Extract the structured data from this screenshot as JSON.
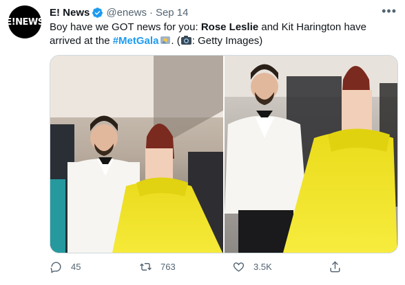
{
  "account": {
    "avatar_text": "E!NEWS",
    "display_name": "E! News",
    "handle": "@enews",
    "separator": "·",
    "date": "Sep 14",
    "verified_icon": "verified-badge-icon"
  },
  "tweet": {
    "text_part1": "Boy have we GOT news for you: ",
    "name1": "Rose Leslie",
    "text_part2": " and Kit Harington have arrived at the ",
    "hashtag": "#MetGala",
    "text_part3": ". (",
    "text_part4": ": Getty Images)"
  },
  "media": {
    "photos": [
      {
        "alt": "Kit Harington and Rose Leslie at the Met Gala"
      },
      {
        "alt": "Kit Harington and Rose Leslie walking at the Met Gala"
      }
    ]
  },
  "actions": {
    "reply_count": "45",
    "retweet_count": "763",
    "like_count": "3.5K",
    "share_label": ""
  },
  "colors": {
    "accent": "#1d9bf0",
    "muted": "#536471",
    "dress_yellow": "#f2e81e"
  }
}
